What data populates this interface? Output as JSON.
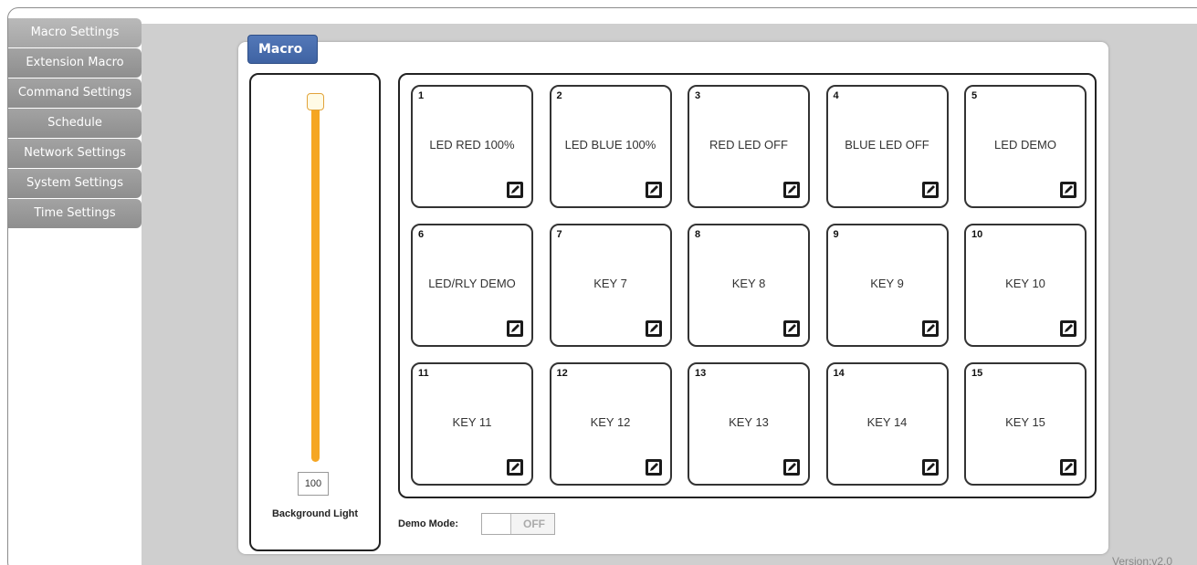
{
  "sidebar": {
    "items": [
      {
        "label": "Macro Settings"
      },
      {
        "label": "Extension Macro"
      },
      {
        "label": "Command Settings"
      },
      {
        "label": "Schedule"
      },
      {
        "label": "Network Settings"
      },
      {
        "label": "System Settings"
      },
      {
        "label": "Time Settings"
      }
    ]
  },
  "panel": {
    "title": "Macro",
    "background_light": {
      "value": "100",
      "label": "Background Light",
      "level_percent": 100
    },
    "keys": [
      {
        "number": "1",
        "label": "LED RED 100%"
      },
      {
        "number": "2",
        "label": "LED BLUE 100%"
      },
      {
        "number": "3",
        "label": "RED LED OFF"
      },
      {
        "number": "4",
        "label": "BLUE LED OFF"
      },
      {
        "number": "5",
        "label": "LED DEMO"
      },
      {
        "number": "6",
        "label": "LED/RLY DEMO"
      },
      {
        "number": "7",
        "label": "KEY 7"
      },
      {
        "number": "8",
        "label": "KEY 8"
      },
      {
        "number": "9",
        "label": "KEY 9"
      },
      {
        "number": "10",
        "label": "KEY 10"
      },
      {
        "number": "11",
        "label": "KEY 11"
      },
      {
        "number": "12",
        "label": "KEY 12"
      },
      {
        "number": "13",
        "label": "KEY 13"
      },
      {
        "number": "14",
        "label": "KEY 14"
      },
      {
        "number": "15",
        "label": "KEY 15"
      }
    ],
    "demo_mode": {
      "label": "Demo Mode:",
      "state": "OFF"
    }
  },
  "version": "Version:v2.0",
  "colors": {
    "accent_blue": "#4a6fb0",
    "slider_orange": "#f5a623",
    "nav_gray": "#999999"
  },
  "icons": {
    "edit": "edit-icon"
  }
}
